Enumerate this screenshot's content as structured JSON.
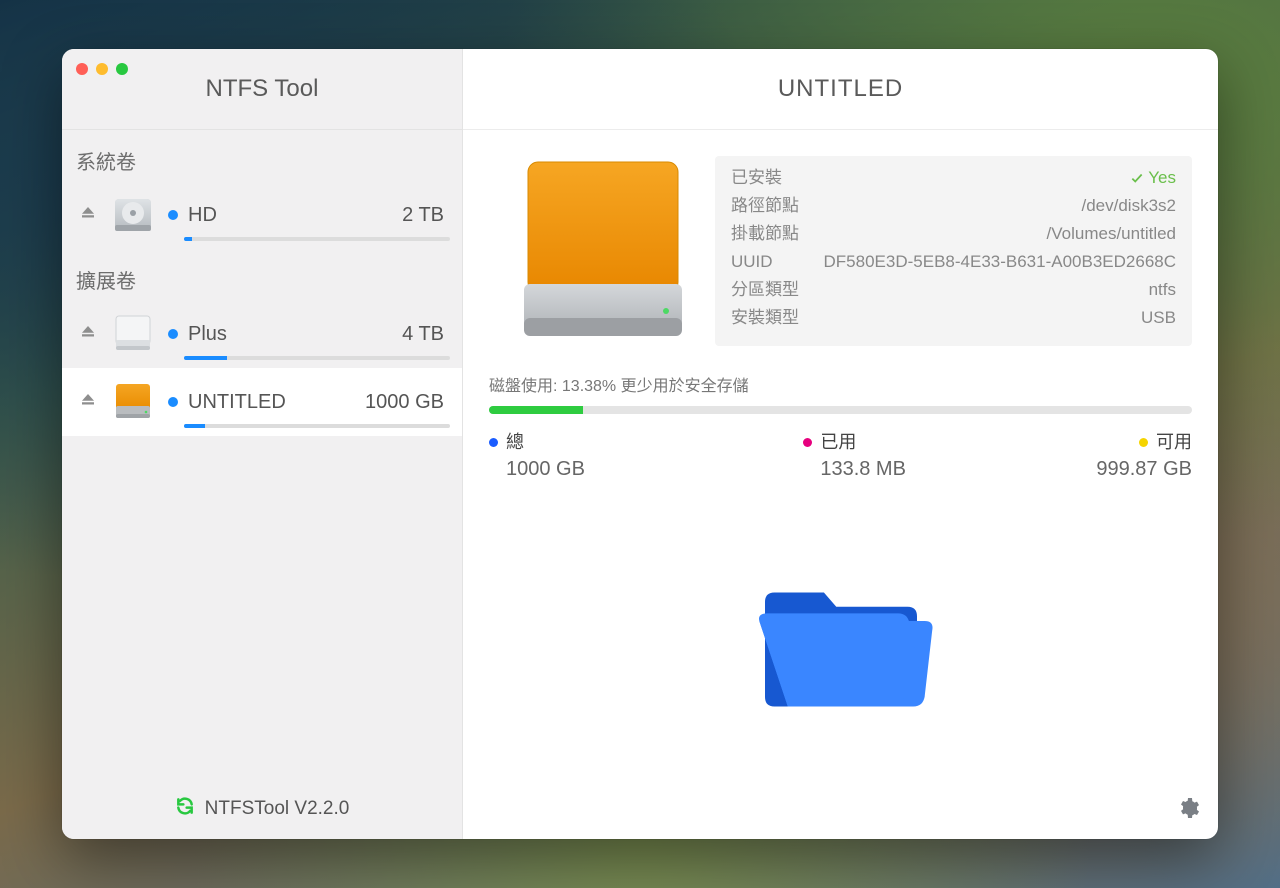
{
  "app_title": "NTFS Tool",
  "main_title": "UNTITLED",
  "sidebar": {
    "section_system": "系統卷",
    "section_ext": "擴展卷",
    "volumes": [
      {
        "name": "HD",
        "size": "2 TB",
        "usage_pct": 3,
        "type": "system"
      },
      {
        "name": "Plus",
        "size": "4 TB",
        "usage_pct": 16,
        "type": "ext"
      },
      {
        "name": "UNTITLED",
        "size": "1000 GB",
        "usage_pct": 8,
        "type": "ext",
        "selected": true
      }
    ]
  },
  "footer": {
    "label": "NTFSTool V2.2.0"
  },
  "info": {
    "mounted_label": "已安裝",
    "mounted_value": "Yes",
    "path_label": "路徑節點",
    "path_value": "/dev/disk3s2",
    "mount_label": "掛載節點",
    "mount_value": "/Volumes/untitled",
    "uuid_label": "UUID",
    "uuid_value": "DF580E3D-5EB8-4E33-B631-A00B3ED2668C",
    "part_label": "分區類型",
    "part_value": "ntfs",
    "inst_label": "安裝類型",
    "inst_value": "USB"
  },
  "usage": {
    "label": "磁盤使用: 13.38%  更少用於安全存儲",
    "bar_pct": 13.38,
    "total_label": "總",
    "total_value": "1000 GB",
    "used_label": "已用",
    "used_value": "133.8 MB",
    "avail_label": "可用",
    "avail_value": "999.87 GB"
  },
  "colors": {
    "total": "#1a5cff",
    "used": "#e6007e",
    "avail": "#f5d400"
  }
}
